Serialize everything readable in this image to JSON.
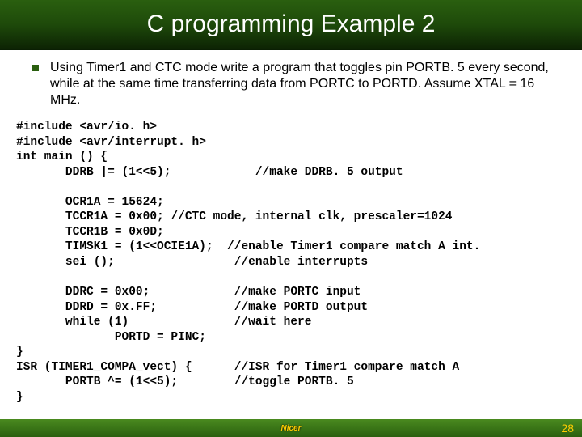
{
  "title": "C programming Example 2",
  "bullet": "Using Timer1 and CTC mode write a program that toggles pin PORTB. 5 every second, while at the same time transferring data from PORTC to PORTD. Assume XTAL = 16 MHz.",
  "code": "#include <avr/io. h>\n#include <avr/interrupt. h>\nint main () {\n       DDRB |= (1<<5);            //make DDRB. 5 output\n\n       OCR1A = 15624;\n       TCCR1A = 0x00; //CTC mode, internal clk, prescaler=1024\n       TCCR1B = 0x0D;\n       TIMSK1 = (1<<OCIE1A);  //enable Timer1 compare match A int.\n       sei ();                 //enable interrupts\n\n       DDRC = 0x00;            //make PORTC input\n       DDRD = 0x.FF;           //make PORTD output\n       while (1)               //wait here\n              PORTD = PINC;\n}\nISR (TIMER1_COMPA_vect) {      //ISR for Timer1 compare match A\n       PORTB ^= (1<<5);        //toggle PORTB. 5\n}",
  "footer_logo": "Nicer",
  "page_number": "28"
}
